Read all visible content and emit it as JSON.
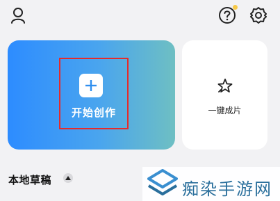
{
  "header": {
    "icons": [
      "user-icon",
      "help-icon",
      "gear-icon"
    ],
    "help_badge_color": "#f7c948"
  },
  "cards": {
    "create": {
      "label": "开始创作",
      "icon": "plus-icon",
      "gradient_from": "#2d8cff",
      "gradient_to": "#6ebfc3"
    },
    "one_click": {
      "label": "一键成片",
      "icon": "sparkle-star-icon"
    }
  },
  "drafts": {
    "title": "本地草稿",
    "toggle_icon": "caret-up-icon"
  },
  "watermark": {
    "text": "痴染手游网"
  }
}
